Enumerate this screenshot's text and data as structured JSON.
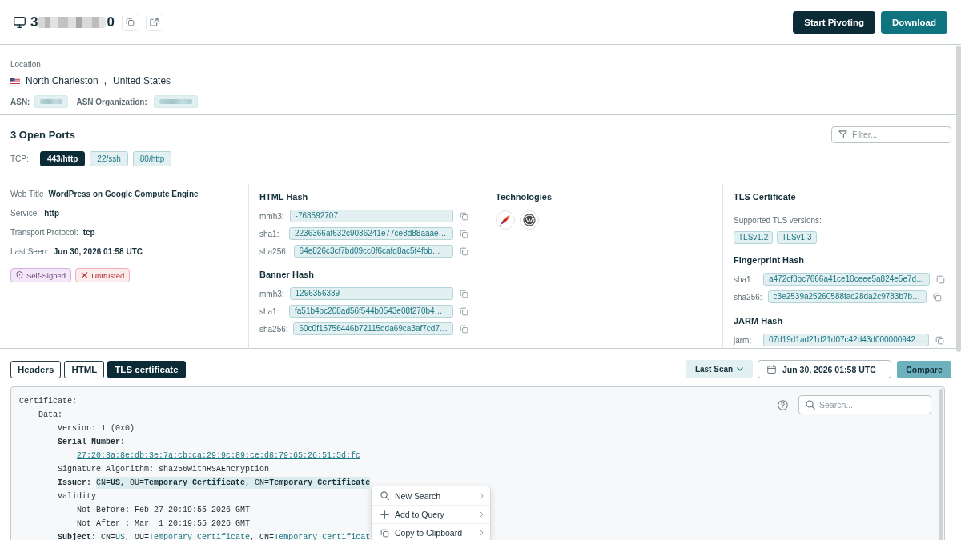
{
  "header": {
    "ip": {
      "start": "3",
      "redacted": true,
      "end": "0"
    },
    "actions": [
      {
        "label": "Start Pivoting",
        "kind": "primary"
      },
      {
        "label": "Download",
        "kind": "secondary"
      }
    ]
  },
  "location": {
    "label": "Location",
    "city": "North Charleston",
    "separator": ",",
    "country": "United States",
    "asn": {
      "label": "ASN:",
      "redacted": true
    },
    "asn_organization": {
      "label": "ASN Organization:",
      "redacted": true
    }
  },
  "ports": {
    "title": "3 Open Ports",
    "filter": {
      "placeholder": "Filter..."
    },
    "protocol": "TCP:",
    "items": [
      {
        "label": "443/http",
        "selected": true
      },
      {
        "label": "22/ssh",
        "selected": false
      },
      {
        "label": "80/http",
        "selected": false
      }
    ]
  },
  "service": {
    "fields": [
      {
        "label": "Web Title",
        "value": "WordPress on Google Compute Engine"
      },
      {
        "label": "Service:",
        "value": "http"
      },
      {
        "label": "Transport Protocol:",
        "value": "tcp"
      },
      {
        "label": "Last Seen:",
        "value": "Jun 30, 2026 01:58 UTC"
      }
    ],
    "badges": [
      {
        "label": "Self-Signed",
        "kind": "shield"
      },
      {
        "label": "Untrusted",
        "kind": "cross"
      }
    ]
  },
  "hashes": [
    {
      "title": "HTML Hash",
      "rows": [
        {
          "label": "mmh3:",
          "value": "-763592707"
        },
        {
          "label": "sha1:",
          "value": "2236366af632c9036241e77ce8d88aaae…"
        },
        {
          "label": "sha256:",
          "value": "64e826c3cf7bd09cc0f6cafd8ac5f4fbb…"
        }
      ]
    },
    {
      "title": "Banner Hash",
      "rows": [
        {
          "label": "mmh3:",
          "value": "1296356339"
        },
        {
          "label": "sha1:",
          "value": "fa51b4bc208ad56f544b0543e08f270b4…"
        },
        {
          "label": "sha256:",
          "value": "60c0f15756446b72115dda69ca3af7cd7…"
        }
      ]
    }
  ],
  "technologies": {
    "title": "Technologies",
    "items": [
      {
        "kind": "feather"
      },
      {
        "kind": "wlogo"
      }
    ]
  },
  "tls": {
    "title": "TLS Certificate",
    "versions_label": "Supported TLS versions:",
    "versions": [
      "TLSv1.2",
      "TLSv1.3"
    ],
    "groups": [
      {
        "title": "Fingerprint Hash",
        "rows": [
          {
            "label": "sha1:",
            "value": "a472cf3bc7666a41ce10ceee5a824e5e7d…"
          },
          {
            "label": "sha256:",
            "value": "c3e2539a25260588fac28da2c9783b7b…"
          }
        ]
      },
      {
        "title": "JARM Hash",
        "rows": [
          {
            "label": "jarm:",
            "value": "07d19d1ad21d21d07c42d43d000000942…"
          }
        ]
      }
    ]
  },
  "viewer": {
    "tabs": [
      {
        "label": "Headers",
        "selected": false
      },
      {
        "label": "HTML",
        "selected": false
      },
      {
        "label": "TLS certificate",
        "selected": true
      }
    ],
    "scan_select": "Last Scan",
    "date": "Jun 30, 2026 01:58 UTC",
    "compare": "Compare",
    "search": {
      "placeholder": "Search..."
    },
    "certificate": [
      {
        "segments": [
          {
            "kind": "text",
            "text": "Certificate:"
          }
        ],
        "highlighted": false,
        "children": [
          {
            "segments": [
              {
                "kind": "text",
                "text": "Data:"
              }
            ],
            "highlighted": false,
            "children": [
              {
                "segments": [
                  {
                    "kind": "text",
                    "text": "Version: 1 (0x0)"
                  }
                ],
                "highlighted": false
              },
              {
                "segments": [
                  {
                    "kind": "key",
                    "text": "Serial Number:"
                  }
                ],
                "highlighted": false,
                "children": [
                  {
                    "segments": [
                      {
                        "kind": "link",
                        "text": "27:20:8a:8e:db:3e:7a:cb:ca:29:9c:89:ce:d8:79:65:26:51:5d:fc"
                      }
                    ],
                    "highlighted": false
                  }
                ]
              },
              {
                "segments": [
                  {
                    "kind": "text",
                    "text": "Signature Algorithm: sha256WithRSAEncryption"
                  }
                ],
                "highlighted": false
              },
              {
                "segments": [
                  {
                    "kind": "key",
                    "text": "Issuer:"
                  },
                  {
                    "kind": "text",
                    "text": "CN="
                  },
                  {
                    "kind": "link",
                    "text": "US"
                  },
                  {
                    "kind": "text",
                    "text": ", OU="
                  },
                  {
                    "kind": "link",
                    "text": "Temporary Certificate"
                  },
                  {
                    "kind": "text",
                    "text": ", CN="
                  },
                  {
                    "kind": "link",
                    "text": "Temporary Certificate"
                  }
                ],
                "highlighted": true
              },
              {
                "segments": [
                  {
                    "kind": "text",
                    "text": "Validity"
                  }
                ],
                "highlighted": false,
                "children": [
                  {
                    "segments": [
                      {
                        "kind": "text",
                        "text": "Not Before: Feb 27 20:19:55 2026 GMT"
                      }
                    ],
                    "highlighted": false
                  },
                  {
                    "segments": [
                      {
                        "kind": "text",
                        "text": "Not After : Mar  1 20:19:55 2026 GMT"
                      }
                    ],
                    "highlighted": false
                  }
                ]
              },
              {
                "segments": [
                  {
                    "kind": "key",
                    "text": "Subject:"
                  },
                  {
                    "kind": "text",
                    "text": "CN="
                  },
                  {
                    "kind": "link",
                    "text": "US"
                  },
                  {
                    "kind": "text",
                    "text": ", OU="
                  },
                  {
                    "kind": "link",
                    "text": "Temporary Certificate"
                  },
                  {
                    "kind": "text",
                    "text": ", CN="
                  },
                  {
                    "kind": "link",
                    "text": "Temporary Certificat"
                  }
                ],
                "highlighted": false
              }
            ]
          }
        ]
      }
    ]
  },
  "context_menu": {
    "items": [
      {
        "label": "New Search",
        "kind": "search",
        "submenu": true
      },
      {
        "label": "Add to Query",
        "kind": "add",
        "submenu": true
      },
      {
        "label": "Copy to Clipboard",
        "kind": "copy",
        "submenu": true
      }
    ]
  }
}
